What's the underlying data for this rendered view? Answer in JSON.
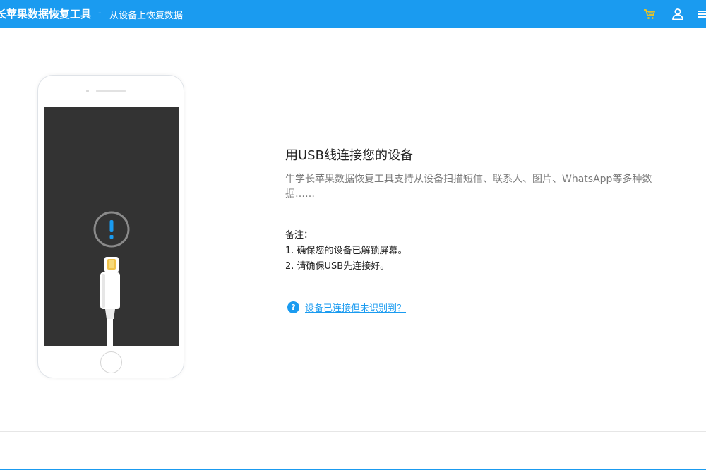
{
  "titlebar": {
    "app_name": "长苹果数据恢复工具",
    "separator": "-",
    "subtitle": "从设备上恢复数据"
  },
  "icons": {
    "cart": "cart-icon",
    "user": "user-icon",
    "menu": "menu-icon",
    "alert": "exclamation-icon",
    "help": "question-icon"
  },
  "colors": {
    "primary": "#1a9bf0",
    "cart": "#f5c518",
    "phone_screen": "#333333"
  },
  "main": {
    "heading": "用USB线连接您的设备",
    "description": "牛学长苹果数据恢复工具支持从设备扫描短信、联系人、图片、WhatsApp等多种数据……",
    "note_title": "备注：",
    "notes": [
      "1. 确保您的设备已解锁屏幕。",
      "2. 请确保USB先连接好。"
    ],
    "help_glyph": "?",
    "help_link": "设备已连接但未识别到？"
  }
}
